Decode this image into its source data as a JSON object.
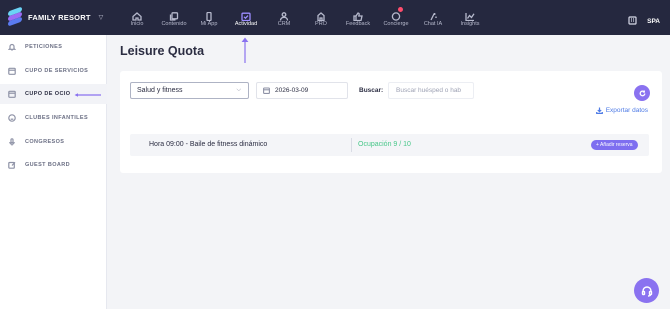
{
  "brand": {
    "name": "FAMILY RESORT"
  },
  "nav": {
    "items": [
      {
        "label": "Inicio",
        "icon": "home-icon"
      },
      {
        "label": "Contenido",
        "icon": "copy-icon"
      },
      {
        "label": "Mi App",
        "icon": "phone-icon"
      },
      {
        "label": "Actividad",
        "icon": "calendar-check-icon",
        "active": true
      },
      {
        "label": "CRM",
        "icon": "users-icon"
      },
      {
        "label": "PRO",
        "icon": "briefcase-icon"
      },
      {
        "label": "Feedback",
        "icon": "thumbs-up-icon"
      },
      {
        "label": "Concierge",
        "icon": "chat-icon"
      },
      {
        "label": "Chat IA",
        "icon": "sparkles-icon"
      },
      {
        "label": "Insights",
        "icon": "chart-icon"
      }
    ]
  },
  "topright": {
    "spa_label": "SPA"
  },
  "sidebar": {
    "items": [
      {
        "label": "PETICIONES",
        "icon": "bell-icon"
      },
      {
        "label": "CUPO DE SERVICIOS",
        "icon": "calendar-icon"
      },
      {
        "label": "CUPO DE OCIO",
        "icon": "calendar-icon",
        "active": true
      },
      {
        "label": "CLUBES INFANTILES",
        "icon": "smile-icon"
      },
      {
        "label": "CONGRESOS",
        "icon": "mic-icon"
      },
      {
        "label": "GUEST BOARD",
        "icon": "edit-icon"
      }
    ]
  },
  "page": {
    "title": "Leisure Quota"
  },
  "filters": {
    "category": "Salud y fitness",
    "date": "2026-03-09",
    "search_label": "Buscar:",
    "search_placeholder": "Buscar huésped o hab"
  },
  "export": {
    "label": "Exportar datos"
  },
  "slots": [
    {
      "time": "Hora 09:00 - Baile de fitness dinámico",
      "occupancy": "Ocupación 9 / 10",
      "add_label": "+ Añadir reserva"
    }
  ],
  "colors": {
    "accent": "#8a72f0",
    "topbar": "#25283f",
    "occupancy": "#48c789",
    "link": "#4e7be6",
    "annotation_arrow": "#8a72f0"
  }
}
